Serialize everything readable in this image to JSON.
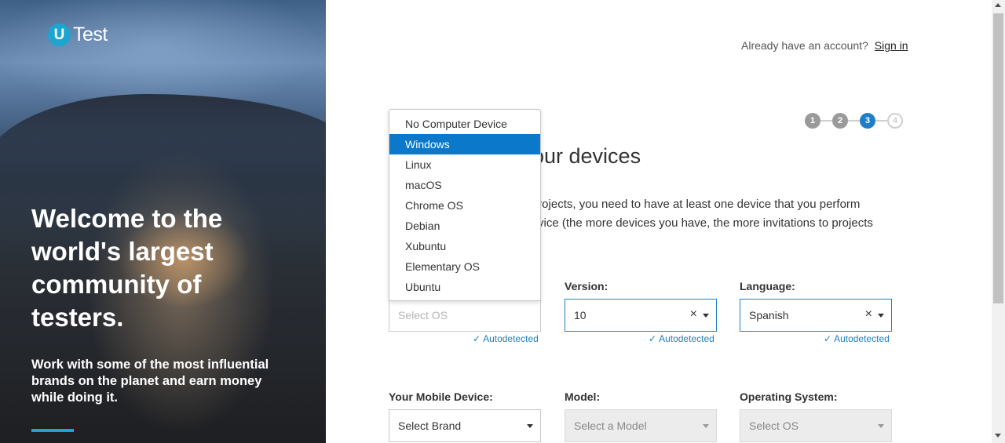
{
  "brand": {
    "logo_mark": "U",
    "logo_text": "Test",
    "accent_color": "#1ca5d0"
  },
  "hero": {
    "title": "Welcome to the world's largest community of testers.",
    "subtitle": "Work with some of the most influential brands on the planet and earn money while doing it."
  },
  "header": {
    "account_prompt": "Already have an account?",
    "signin_label": "Sign in"
  },
  "stepper": {
    "steps": [
      "1",
      "2",
      "3",
      "4"
    ],
    "current": 3
  },
  "section": {
    "title_visible": "our devices",
    "intro_line1": "st projects, you need to have at least one device that you perform",
    "intro_line2": "vice (the more devices you have, the more invitations to projects"
  },
  "computer": {
    "os_placeholder": "Select OS",
    "version_label": "Version:",
    "version_value": "10",
    "language_label": "Language:",
    "language_value": "Spanish",
    "autodetected": "Autodetected"
  },
  "os_dropdown": {
    "options": [
      "No Computer Device",
      "Windows",
      "Linux",
      "macOS",
      "Chrome OS",
      "Debian",
      "Xubuntu",
      "Elementary OS",
      "Ubuntu"
    ],
    "selected": "Windows"
  },
  "mobile": {
    "device_label": "Your Mobile Device:",
    "brand_placeholder": "Select Brand",
    "model_label": "Model:",
    "model_placeholder": "Select a Model",
    "os_label": "Operating System:",
    "os_placeholder": "Select OS"
  },
  "colors": {
    "primary": "#1f7fc6",
    "selected_option": "#0b78c9"
  }
}
